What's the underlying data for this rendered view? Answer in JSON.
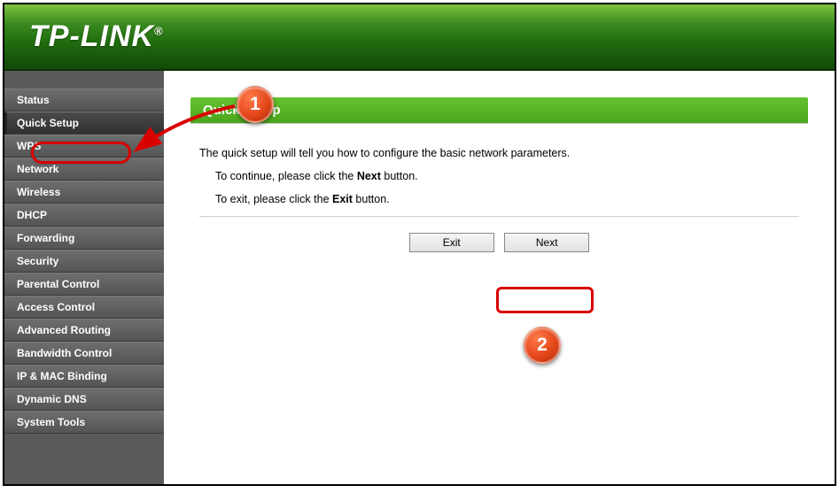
{
  "header": {
    "brand": "TP-LINK"
  },
  "sidebar": {
    "items": [
      {
        "label": "Status"
      },
      {
        "label": "Quick Setup"
      },
      {
        "label": "WPS"
      },
      {
        "label": "Network"
      },
      {
        "label": "Wireless"
      },
      {
        "label": "DHCP"
      },
      {
        "label": "Forwarding"
      },
      {
        "label": "Security"
      },
      {
        "label": "Parental Control"
      },
      {
        "label": "Access Control"
      },
      {
        "label": "Advanced Routing"
      },
      {
        "label": "Bandwidth Control"
      },
      {
        "label": "IP & MAC Binding"
      },
      {
        "label": "Dynamic DNS"
      },
      {
        "label": "System Tools"
      }
    ],
    "selected_index": 1
  },
  "main": {
    "title": "Quick Setup",
    "intro": "The quick setup will tell you how to configure the basic network parameters.",
    "line_continue_pre": "To continue, please click the ",
    "line_continue_bold": "Next",
    "line_continue_post": " button.",
    "line_exit_pre": "To exit, please click the ",
    "line_exit_bold": "Exit",
    "line_exit_post": " button.",
    "buttons": {
      "exit": "Exit",
      "next": "Next"
    }
  },
  "annotations": {
    "badge1": "1",
    "badge2": "2"
  }
}
